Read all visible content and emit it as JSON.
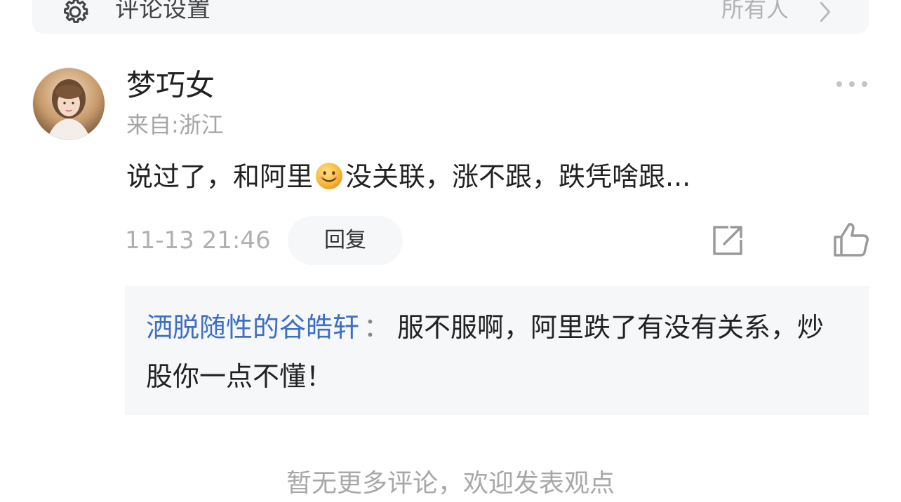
{
  "settings": {
    "label": "评论设置",
    "value": "所有人",
    "icon": "gear-icon",
    "chevron_icon": "chevron-right-icon"
  },
  "comment": {
    "author": "梦巧女",
    "location": "来自:浙江",
    "text_before_emoji": "说过了，和阿里",
    "emoji": "smile-emoji-icon",
    "text_after_emoji": "没关联，涨不跟，跌凭啥跟...",
    "timestamp": "11-13 21:46",
    "reply_label": "回复",
    "more_icon": "more-dots-icon",
    "share_icon": "share-icon",
    "like_icon": "thumbs-up-icon"
  },
  "reply": {
    "user": "洒脱随性的谷皓轩",
    "separator": "：",
    "text": "服不服啊，阿里跌了有没有关系，炒股你一点不懂！"
  },
  "footer": {
    "text": "暂无更多评论，欢迎发表观点"
  },
  "colors": {
    "link_blue": "#3d6fc4",
    "muted_gray": "#a6a6a6",
    "panel_bg": "#f6f7f9"
  }
}
